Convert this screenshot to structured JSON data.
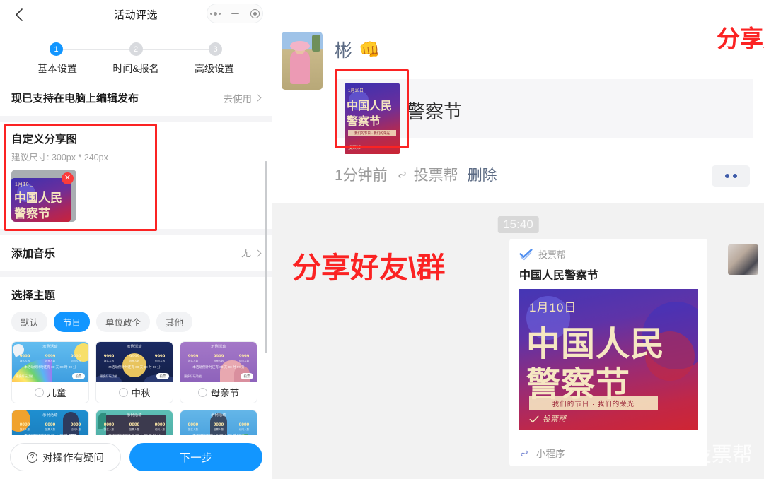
{
  "left_panel": {
    "nav": {
      "back_icon": "chevron-left-icon",
      "title": "活动评选",
      "capsule": {
        "menu_icon": "more-dots-icon",
        "minimize_icon": "minimize-icon",
        "close_icon": "target-circle-icon"
      }
    },
    "stepper": {
      "steps": [
        {
          "num": "1",
          "label": "基本设置",
          "active": true
        },
        {
          "num": "2",
          "label": "时间&报名",
          "active": false
        },
        {
          "num": "3",
          "label": "高级设置",
          "active": false
        }
      ]
    },
    "notice": {
      "text": "现已支持在电脑上编辑发布",
      "link": "去使用",
      "chevron_icon": "chevron-right-icon"
    },
    "share_image": {
      "title": "自定义分享图",
      "subtitle": "建议尺寸: 300px * 240px",
      "delete_badge": "✕",
      "thumb": {
        "date": "1月10日",
        "line1": "中国人民",
        "line2": "警察节"
      }
    },
    "music": {
      "label": "添加音乐",
      "value": "无",
      "chevron_icon": "chevron-right-icon"
    },
    "theme": {
      "title": "选择主题",
      "chips": [
        {
          "label": "默认",
          "active": false
        },
        {
          "label": "节日",
          "active": true
        },
        {
          "label": "单位政企",
          "active": false
        },
        {
          "label": "其他",
          "active": false
        }
      ],
      "card_sample": {
        "head": "示例活动",
        "nums": [
          "9999",
          "9999",
          "9999"
        ],
        "num_labels": [
          "报名人数",
          "投票人数",
          "访问人数"
        ],
        "line": "本活动倒计时还有 00 天 00 时 00 分",
        "foot": "更多好玩功能",
        "btn": "投票"
      },
      "cards": [
        {
          "label": "儿童",
          "art": "art-kids"
        },
        {
          "label": "中秋",
          "art": "art-moon"
        },
        {
          "label": "母亲节",
          "art": "art-mom"
        },
        {
          "label": "",
          "art": "art-baby"
        },
        {
          "label": "",
          "art": "art-teal"
        },
        {
          "label": "",
          "art": "art-blue2"
        }
      ]
    },
    "footer": {
      "help_label": "对操作有疑问",
      "help_icon": "question-circle-icon",
      "next_label": "下一步"
    }
  },
  "right_panel": {
    "annotations": {
      "moments": "分享朋友圈",
      "chat": "分享好友\\群",
      "color": "#fb2323"
    },
    "moments": {
      "avatar_icon": "user-avatar-photo",
      "username": "彬",
      "emoji": "👊",
      "post_title": "警察节",
      "thumb": {
        "date": "1月10日",
        "line1": "中国人民",
        "line2": "警察节",
        "band": "我们的节日 · 我们的荣光",
        "logo": "投票帮"
      },
      "meta": {
        "time": "1分钟前",
        "app_icon": "miniprogram-icon",
        "app": "投票帮",
        "delete": "删除"
      },
      "more_icon": "more-dots-icon"
    },
    "chat": {
      "timestamp": "15:40",
      "sender_avatar_icon": "contact-avatar-photo",
      "card": {
        "logo_icon": "toupiaobang-check-icon",
        "app_name": "投票帮",
        "title": "中国人民警察节",
        "poster": {
          "date": "1月10日",
          "line1": "中国人民",
          "line2": "警察节",
          "band": "我们的节日 · 我们的荣光",
          "logo": "投票帮"
        },
        "footer_icon": "miniprogram-icon",
        "footer_text": "小程序"
      },
      "watermark": "百家号·投票帮"
    }
  }
}
